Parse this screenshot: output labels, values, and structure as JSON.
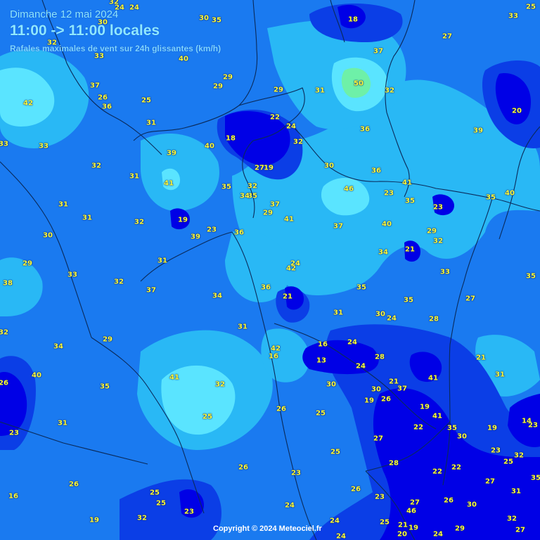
{
  "header": {
    "date": "Dimanche 12 mai 2024",
    "time": "11:00 -> 11:00 locales",
    "subtitle": "Rafales maximales de vent sur 24h glissantes (km/h)"
  },
  "copyright": "Copyright © 2024 Meteociel.fr",
  "colors": {
    "level_13_22": "#0000e6",
    "level_22_27": "#0b3ee6",
    "level_27_34": "#1a7af0",
    "level_34_40": "#29b8f5",
    "level_40_47": "#5ae4ff",
    "level_47_55": "#6ef0a8",
    "label_text": "#ffff3a",
    "borders": "#0a2a5a"
  },
  "gusts": [
    {
      "id": "g1",
      "v": "24"
    },
    {
      "id": "g2",
      "v": "32"
    },
    {
      "id": "g3",
      "v": "24"
    },
    {
      "id": "g4",
      "v": "30"
    },
    {
      "id": "g5",
      "v": "35"
    },
    {
      "id": "g6",
      "v": "30"
    },
    {
      "id": "g7",
      "v": "18"
    },
    {
      "id": "g8",
      "v": "33"
    },
    {
      "id": "g9",
      "v": "25"
    },
    {
      "id": "g10",
      "v": "32"
    },
    {
      "id": "g11",
      "v": "40"
    },
    {
      "id": "g12",
      "v": "33"
    },
    {
      "id": "g13",
      "v": "37"
    },
    {
      "id": "g14",
      "v": "27"
    },
    {
      "id": "g15",
      "v": "29"
    },
    {
      "id": "g16",
      "v": "29"
    },
    {
      "id": "g17",
      "v": "29"
    },
    {
      "id": "g18",
      "v": "31"
    },
    {
      "id": "g19",
      "v": "50"
    },
    {
      "id": "g20",
      "v": "32"
    },
    {
      "id": "g21",
      "v": "37"
    },
    {
      "id": "g22",
      "v": "42"
    },
    {
      "id": "g23",
      "v": "26"
    },
    {
      "id": "g24",
      "v": "36"
    },
    {
      "id": "g25",
      "v": "25"
    },
    {
      "id": "g26",
      "v": "20"
    },
    {
      "id": "g27",
      "v": "22"
    },
    {
      "id": "g28",
      "v": "24"
    },
    {
      "id": "g29",
      "v": "36"
    },
    {
      "id": "g30",
      "v": "39"
    },
    {
      "id": "g31",
      "v": "31"
    },
    {
      "id": "g32",
      "v": "33"
    },
    {
      "id": "g33",
      "v": "33"
    },
    {
      "id": "g34",
      "v": "39"
    },
    {
      "id": "g35",
      "v": "40"
    },
    {
      "id": "g36",
      "v": "18"
    },
    {
      "id": "g37",
      "v": "32"
    },
    {
      "id": "g38",
      "v": "32"
    },
    {
      "id": "g39",
      "v": "31"
    },
    {
      "id": "g40",
      "v": "27"
    },
    {
      "id": "g41",
      "v": "19"
    },
    {
      "id": "g42",
      "v": "30"
    },
    {
      "id": "g43",
      "v": "36"
    },
    {
      "id": "g44",
      "v": "41"
    },
    {
      "id": "g45",
      "v": "35"
    },
    {
      "id": "g46",
      "v": "32"
    },
    {
      "id": "g47",
      "v": "35"
    },
    {
      "id": "g48",
      "v": "34"
    },
    {
      "id": "g49",
      "v": "46"
    },
    {
      "id": "g50",
      "v": "23"
    },
    {
      "id": "g51",
      "v": "41"
    },
    {
      "id": "g52",
      "v": "35"
    },
    {
      "id": "g53",
      "v": "35"
    },
    {
      "id": "g54",
      "v": "40"
    },
    {
      "id": "g55",
      "v": "31"
    },
    {
      "id": "g56",
      "v": "31"
    },
    {
      "id": "g57",
      "v": "37"
    },
    {
      "id": "g58",
      "v": "29"
    },
    {
      "id": "g59",
      "v": "23"
    },
    {
      "id": "g60",
      "v": "19"
    },
    {
      "id": "g61",
      "v": "23"
    },
    {
      "id": "g62",
      "v": "32"
    },
    {
      "id": "g63",
      "v": "41"
    },
    {
      "id": "g64",
      "v": "37"
    },
    {
      "id": "g65",
      "v": "40"
    },
    {
      "id": "g66",
      "v": "36"
    },
    {
      "id": "g67",
      "v": "29"
    },
    {
      "id": "g68",
      "v": "30"
    },
    {
      "id": "g69",
      "v": "39"
    },
    {
      "id": "g70",
      "v": "32"
    },
    {
      "id": "g71",
      "v": "34"
    },
    {
      "id": "g72",
      "v": "21"
    },
    {
      "id": "g73",
      "v": "29"
    },
    {
      "id": "g74",
      "v": "31"
    },
    {
      "id": "g75",
      "v": "42"
    },
    {
      "id": "g76",
      "v": "24"
    },
    {
      "id": "g77",
      "v": "33"
    },
    {
      "id": "g78",
      "v": "33"
    },
    {
      "id": "g79",
      "v": "35"
    },
    {
      "id": "g80",
      "v": "38"
    },
    {
      "id": "g81",
      "v": "32"
    },
    {
      "id": "g82",
      "v": "37"
    },
    {
      "id": "g83",
      "v": "34"
    },
    {
      "id": "g84",
      "v": "36"
    },
    {
      "id": "g85",
      "v": "35"
    },
    {
      "id": "g86",
      "v": "21"
    },
    {
      "id": "g87",
      "v": "35"
    },
    {
      "id": "g88",
      "v": "27"
    },
    {
      "id": "g89",
      "v": "30"
    },
    {
      "id": "g90",
      "v": "24"
    },
    {
      "id": "g91",
      "v": "31"
    },
    {
      "id": "g92",
      "v": "28"
    },
    {
      "id": "g93",
      "v": "32"
    },
    {
      "id": "g94",
      "v": "31"
    },
    {
      "id": "g95",
      "v": "29"
    },
    {
      "id": "g96",
      "v": "16"
    },
    {
      "id": "g97",
      "v": "34"
    },
    {
      "id": "g98",
      "v": "24"
    },
    {
      "id": "g99",
      "v": "42"
    },
    {
      "id": "g100",
      "v": "16"
    },
    {
      "id": "g101",
      "v": "13"
    },
    {
      "id": "g102",
      "v": "28"
    },
    {
      "id": "g103",
      "v": "24"
    },
    {
      "id": "g104",
      "v": "21"
    },
    {
      "id": "g105",
      "v": "26"
    },
    {
      "id": "g106",
      "v": "40"
    },
    {
      "id": "g107",
      "v": "41"
    },
    {
      "id": "g108",
      "v": "31"
    },
    {
      "id": "g109",
      "v": "35"
    },
    {
      "id": "g110",
      "v": "21"
    },
    {
      "id": "g111",
      "v": "37"
    },
    {
      "id": "g112",
      "v": "30"
    },
    {
      "id": "g113",
      "v": "30"
    },
    {
      "id": "g114",
      "v": "41"
    },
    {
      "id": "g115",
      "v": "32"
    },
    {
      "id": "g116",
      "v": "19"
    },
    {
      "id": "g117",
      "v": "26"
    },
    {
      "id": "g118",
      "v": "26"
    },
    {
      "id": "g119",
      "v": "31"
    },
    {
      "id": "g120",
      "v": "25"
    },
    {
      "id": "g121",
      "v": "19"
    },
    {
      "id": "g122",
      "v": "41"
    },
    {
      "id": "g123",
      "v": "25"
    },
    {
      "id": "g124",
      "v": "23"
    },
    {
      "id": "g125",
      "v": "22"
    },
    {
      "id": "g126",
      "v": "35"
    },
    {
      "id": "g127",
      "v": "19"
    },
    {
      "id": "g128",
      "v": "14"
    },
    {
      "id": "g129",
      "v": "23"
    },
    {
      "id": "g130",
      "v": "30"
    },
    {
      "id": "g131",
      "v": "27"
    },
    {
      "id": "g132",
      "v": "25"
    },
    {
      "id": "g133",
      "v": "23"
    },
    {
      "id": "g134",
      "v": "32"
    },
    {
      "id": "g135",
      "v": "26"
    },
    {
      "id": "g136",
      "v": "23"
    },
    {
      "id": "g137",
      "v": "28"
    },
    {
      "id": "g138",
      "v": "22"
    },
    {
      "id": "g139",
      "v": "22"
    },
    {
      "id": "g140",
      "v": "25"
    },
    {
      "id": "g141",
      "v": "26"
    },
    {
      "id": "g142",
      "v": "35"
    },
    {
      "id": "g143",
      "v": "25"
    },
    {
      "id": "g144",
      "v": "26"
    },
    {
      "id": "g145",
      "v": "23"
    },
    {
      "id": "g146",
      "v": "27"
    },
    {
      "id": "g147",
      "v": "31"
    },
    {
      "id": "g148",
      "v": "16"
    },
    {
      "id": "g149",
      "v": "25"
    },
    {
      "id": "g150",
      "v": "24"
    },
    {
      "id": "g151",
      "v": "27"
    },
    {
      "id": "g152",
      "v": "26"
    },
    {
      "id": "g153",
      "v": "30"
    },
    {
      "id": "g154",
      "v": "23"
    },
    {
      "id": "g155",
      "v": "46"
    },
    {
      "id": "g156",
      "v": "32"
    },
    {
      "id": "g157",
      "v": "19"
    },
    {
      "id": "g158",
      "v": "32"
    },
    {
      "id": "g159",
      "v": "24"
    },
    {
      "id": "g160",
      "v": "25"
    },
    {
      "id": "g161",
      "v": "21"
    },
    {
      "id": "g162",
      "v": "19"
    },
    {
      "id": "g163",
      "v": "20"
    },
    {
      "id": "g164",
      "v": "24"
    },
    {
      "id": "g165",
      "v": "29"
    },
    {
      "id": "g166",
      "v": "27"
    },
    {
      "id": "g167",
      "v": "24"
    }
  ]
}
